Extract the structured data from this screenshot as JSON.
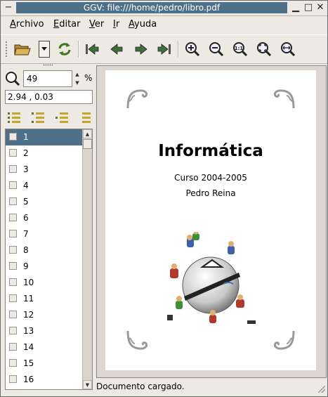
{
  "window": {
    "title": "GGV: file:///home/pedro/libro.pdf",
    "title_button_left": "−",
    "min_button": "▁",
    "max_button": "□",
    "close_button": "✕"
  },
  "menubar": {
    "items": [
      {
        "label": "Archivo",
        "ul": "A",
        "rest": "rchivo"
      },
      {
        "label": "Editar",
        "ul": "E",
        "rest": "ditar"
      },
      {
        "label": "Ver",
        "ul": "V",
        "rest": "er"
      },
      {
        "label": "Ir",
        "ul": "I",
        "rest": "r"
      },
      {
        "label": "Ayuda",
        "ul": "A",
        "rest": "yuda"
      }
    ]
  },
  "toolbar": {
    "icons": [
      "open-folder-icon",
      "dropdown-arrow-icon",
      "reload-icon",
      "first-page-icon",
      "previous-page-icon",
      "next-page-icon",
      "last-page-icon",
      "zoom-in-icon",
      "zoom-out-icon",
      "zoom-1-1-icon",
      "zoom-fit-page-icon",
      "zoom-fit-width-icon"
    ],
    "zoom_1_1_text": "1:1"
  },
  "side": {
    "zoom_value": "49",
    "zoom_unit": "%",
    "spin_up": "▲",
    "spin_down": "▼",
    "coords": "2.94 , 0.03",
    "pages": [
      "1",
      "2",
      "3",
      "4",
      "5",
      "6",
      "7",
      "8",
      "9",
      "10",
      "11",
      "12",
      "13",
      "14",
      "15",
      "16"
    ],
    "selected_page": "1",
    "scroll_up": "▲",
    "scroll_down": "▼"
  },
  "document": {
    "title": "Informática",
    "course": "Curso 2004-2005",
    "author": "Pedro Reina"
  },
  "status": {
    "text": "Documento cargado."
  },
  "colors": {
    "selection": "#4e7088",
    "background": "#ede9e3"
  }
}
